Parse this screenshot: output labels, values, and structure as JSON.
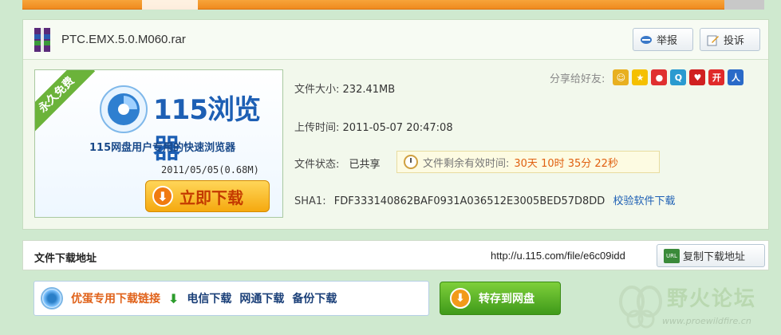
{
  "file": {
    "name": "PTC.EMX.5.0.M060.rar"
  },
  "actions": {
    "report_label": "举报",
    "complain_label": "投诉"
  },
  "ad": {
    "ribbon": "永久免费",
    "title": "115浏览器",
    "subtitle": "115网盘用户专用的快速浏览器",
    "version": "2011/05/05(0.68M)",
    "download_label": "立即下载"
  },
  "share": {
    "label": "分享给好友:",
    "icons": [
      "smiley-icon",
      "star-icon",
      "weibo-icon",
      "qq-icon",
      "renren-icon",
      "kaixin-icon",
      "people-icon"
    ]
  },
  "info": {
    "size_label": "文件大小:",
    "size_value": "232.41MB",
    "time_label": "上传时间:",
    "time_value": "2011-05-07 20:47:08",
    "status_label": "文件状态:",
    "status_value": "已共享",
    "expire_label": "文件剩余有效时间:",
    "expire_value": "30天 10时 35分 22秒",
    "sha_label": "SHA1:",
    "sha_value": "FDF333140862BAF0931A036512E3005BED57D8DD",
    "sha_link": "校验软件下载"
  },
  "address": {
    "title": "文件下载地址",
    "url": "http://u.115.com/file/e6c09idd",
    "copy_label": "复制下载地址",
    "url_badge": "URL"
  },
  "download_links": {
    "vip_label": "优蛋专用下载链接",
    "telecom_label": "电信下载",
    "netcom_label": "网通下载",
    "backup_label": "备份下载"
  },
  "save": {
    "label": "转存到网盘"
  },
  "watermark": {
    "title": "野火论坛",
    "url": "www.proewildfire.cn"
  },
  "colors": {
    "background": "#cfe9cf",
    "accent_orange": "#e0621a",
    "accent_blue": "#1d5fb4",
    "save_green": "#3f9a1a"
  }
}
